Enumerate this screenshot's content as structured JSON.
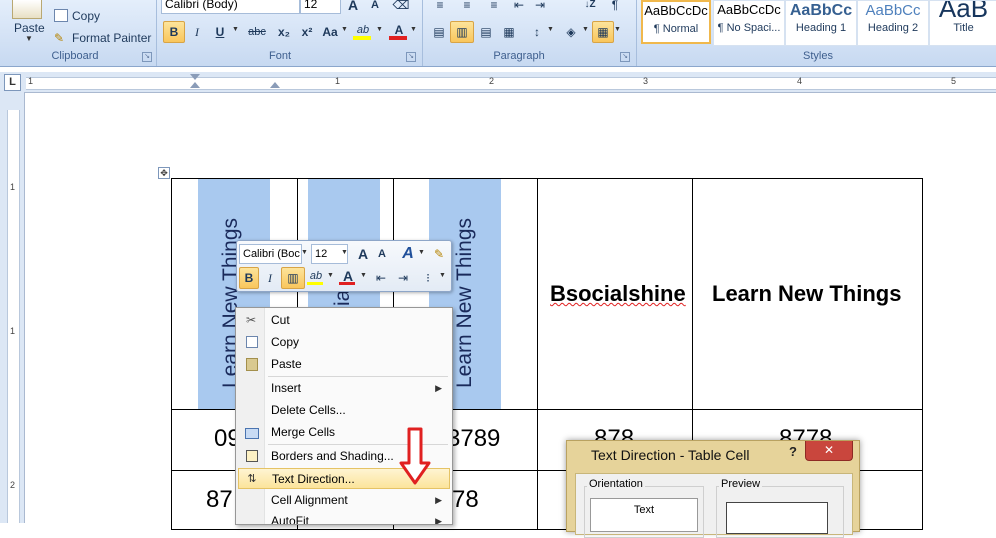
{
  "clipboard": {
    "paste_label": "Paste",
    "copy_label": "Copy",
    "format_painter_label": "Format Painter",
    "group_label": "Clipboard"
  },
  "font": {
    "font_name": "Calibri (Body)",
    "font_size": "12",
    "grow_label": "A",
    "shrink_label": "A",
    "bold_label": "B",
    "italic_label": "I",
    "underline_label": "U",
    "strike_label": "abc",
    "subscript_label": "x₂",
    "superscript_label": "x²",
    "case_label": "Aa",
    "highlight_label": "ab",
    "color_label": "A",
    "group_label": "Font"
  },
  "paragraph": {
    "group_label": "Paragraph",
    "sort_label": "↓Z"
  },
  "styles": {
    "group_label": "Styles",
    "tiles": [
      {
        "sample": "AaBbCcDc",
        "name": "¶ Normal"
      },
      {
        "sample": "AaBbCcDc",
        "name": "¶ No Spaci..."
      },
      {
        "sample": "AaBbCc",
        "name": "Heading 1"
      },
      {
        "sample": "AaBbCc",
        "name": "Heading 2"
      },
      {
        "sample": "AaB",
        "name": "Title"
      }
    ]
  },
  "ruler": {
    "tab_selector": "L",
    "marks": [
      "1",
      "1",
      "2",
      "3",
      "4",
      "5"
    ],
    "vmarks": [
      "1",
      "1",
      "2"
    ]
  },
  "table": {
    "header_vertical": [
      "Learn New Things",
      "ia",
      "Learn New Things"
    ],
    "header_horizontal": [
      "Bsocialshine",
      "Learn New Things"
    ],
    "row1": [
      "09",
      "3789",
      "878",
      "8778"
    ],
    "row2": [
      "87",
      "78"
    ]
  },
  "mini_toolbar": {
    "font_name": "Calibri (Boc",
    "font_size": "12",
    "bold_label": "B",
    "italic_label": "I",
    "grow_label": "A",
    "shrink_label": "A",
    "style_label": "A",
    "highlight_label": "ab",
    "color_label": "A"
  },
  "context_menu": {
    "items": [
      {
        "label": "Cut",
        "icon": "scissors-icon"
      },
      {
        "label": "Copy",
        "icon": "copy-icon"
      },
      {
        "label": "Paste",
        "icon": "paste-icon"
      },
      {
        "label": "Insert",
        "icon": "",
        "submenu": true
      },
      {
        "label": "Delete Cells...",
        "icon": ""
      },
      {
        "label": "Merge Cells",
        "icon": "merge-cells-icon"
      },
      {
        "label": "Borders and Shading...",
        "icon": "borders-icon"
      },
      {
        "label": "Text Direction...",
        "icon": "text-direction-icon",
        "selected": true
      },
      {
        "label": "Cell Alignment",
        "icon": "",
        "submenu": true
      },
      {
        "label": "AutoFit",
        "icon": "",
        "submenu": true
      }
    ]
  },
  "dialog": {
    "title": "Text Direction - Table Cell",
    "help_label": "?",
    "close_label": "✕",
    "orientation_label": "Orientation",
    "preview_label": "Preview",
    "option_text": "Text"
  },
  "colors": {
    "ribbon_top": "#e4eefb",
    "ribbon_bottom": "#c7d9f1",
    "cell_highlight": "#a9c9ef",
    "menu_selection": "#fce49b",
    "dialog_frame": "#e6d39a",
    "close_red": "#c9463d",
    "arrow_red": "#e02020"
  }
}
